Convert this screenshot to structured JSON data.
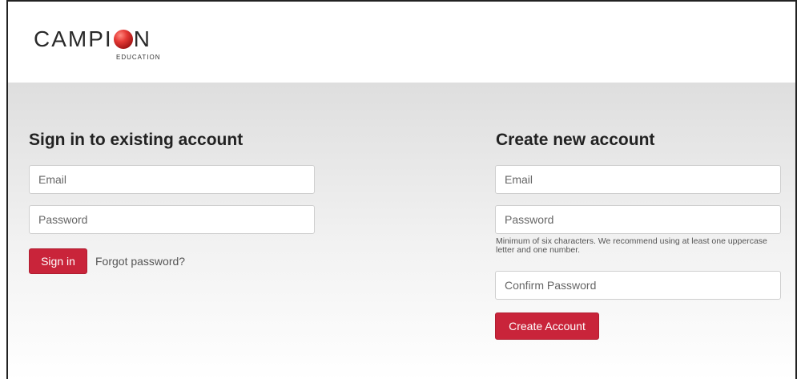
{
  "brand": {
    "name_part1": "CAMPI",
    "name_part2": "N",
    "subtitle": "EDUCATION"
  },
  "signin": {
    "heading": "Sign in to existing account",
    "email_placeholder": "Email",
    "email_value": "",
    "password_placeholder": "Password",
    "password_value": "",
    "submit_label": "Sign in",
    "forgot_label": "Forgot password?"
  },
  "signup": {
    "heading": "Create new account",
    "email_placeholder": "Email",
    "email_value": "",
    "password_placeholder": "Password",
    "password_value": "",
    "password_hint": "Minimum of six characters. We recommend using at least one uppercase letter and one number.",
    "confirm_placeholder": "Confirm Password",
    "confirm_value": "",
    "submit_label": "Create Account"
  },
  "colors": {
    "accent": "#c9243a",
    "logo_ball": "#e53935",
    "heading_text": "#222222",
    "background_gradient_top": "#dedede"
  }
}
